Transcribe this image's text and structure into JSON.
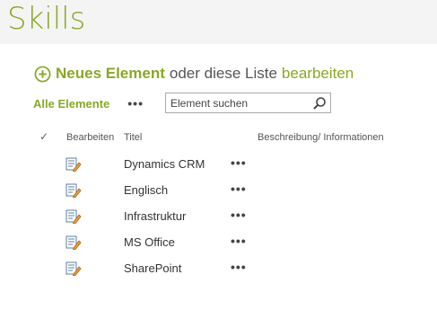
{
  "page": {
    "title": "Skills"
  },
  "command_bar": {
    "new_item_label": "Neues Element",
    "middle_text": "oder diese Liste",
    "edit_label": "bearbeiten",
    "plus_icon": "circle-plus-icon"
  },
  "views": {
    "current_view": "Alle Elemente",
    "more_label": "•••"
  },
  "search": {
    "placeholder": "Element suchen",
    "icon": "magnifier-icon"
  },
  "list": {
    "headers": {
      "check": "✓",
      "edit": "Bearbeiten",
      "title": "Titel",
      "description": "Beschreibung/ Informationen"
    },
    "rows": [
      {
        "title": "Dynamics CRM",
        "more": "•••"
      },
      {
        "title": "Englisch",
        "more": "•••"
      },
      {
        "title": "Infrastruktur",
        "more": "•••"
      },
      {
        "title": "MS Office",
        "more": "•••"
      },
      {
        "title": "SharePoint",
        "more": "•••"
      }
    ]
  },
  "colors": {
    "accent": "#8aa726",
    "title_band": "#f4f4f4",
    "text": "#333333"
  }
}
